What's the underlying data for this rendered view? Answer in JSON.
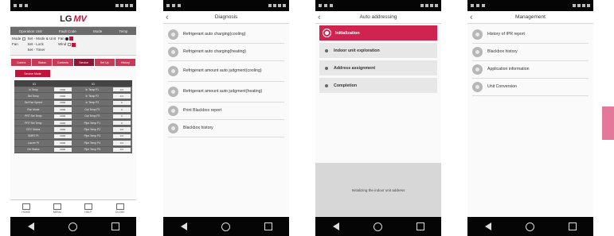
{
  "phone1": {
    "logo_lg": "LG",
    "logo_mv": "MV",
    "head_cols": [
      "Operation Unit",
      "Fault Code",
      "Mode",
      "Temp"
    ],
    "info_left": [
      "Mode",
      "Fan"
    ],
    "info_mid": [
      "Set - Mode & Unit",
      "Set - Lock",
      "Set - Timer"
    ],
    "info_right": [
      "Fan",
      "Wind"
    ],
    "tabs": [
      "Control",
      "Status",
      "Contents",
      "Service",
      "Set Up",
      "History"
    ],
    "active_tab": 3,
    "pink_button": "Service Mode",
    "grid_head": [
      "ID",
      "",
      "ID",
      ""
    ],
    "grid_rows": [
      [
        "In Temp",
        "0000",
        "In Temp P1",
        "0.0"
      ],
      [
        "Set Temp",
        "0000",
        "In Temp P2",
        "0.0"
      ],
      [
        "Set Fan Speed",
        "0000",
        "In Temp P3",
        "0"
      ],
      [
        "Run Mode",
        "0000",
        "Out Temp P1",
        "0"
      ],
      [
        "PRT Set Temp",
        "0000",
        "Out Temp P2",
        "0"
      ],
      [
        "PRT Set Temp",
        "0000",
        "Pipe Temp P1",
        "0"
      ],
      [
        "EEV Status",
        "0000",
        "Pipe Temp P2",
        "0.0"
      ],
      [
        "SMRT Pt",
        "0000",
        "Pipe Temp P3",
        "0.0"
      ],
      [
        "Louver Pt",
        "0000",
        "Pipe Temp P4",
        "0.0"
      ],
      [
        "Ctrl Status",
        "0000",
        "Pipe Temp P5",
        "0.0"
      ]
    ],
    "bottom_tabs": [
      "HOME",
      "MENU",
      "HELP",
      "CLOSE"
    ]
  },
  "phone2": {
    "title": "Diagnosis",
    "items": [
      "Refrigerant auto charging(cooling)",
      "Refrigerant auto charging(heating)",
      "Refrigerant amount auto judgment(cooling)",
      "Refrigerant amount auto judgment(heating)",
      "Print Blackbox report",
      "Blackbox history"
    ]
  },
  "phone3": {
    "title": "Auto addressing",
    "steps": [
      "Initialization",
      "Indoor unit exploration",
      "Address assignment",
      "Completion"
    ],
    "active_step": 0,
    "message": "Initializing the indoor unit address"
  },
  "phone4": {
    "title": "Management",
    "items": [
      "History of IPR report",
      "Blackbox history",
      "Application information",
      "Unit Conversion"
    ]
  },
  "colors": {
    "accent": "#c0143c",
    "active_step": "#cf2350",
    "side_tab": "#e3789a"
  }
}
